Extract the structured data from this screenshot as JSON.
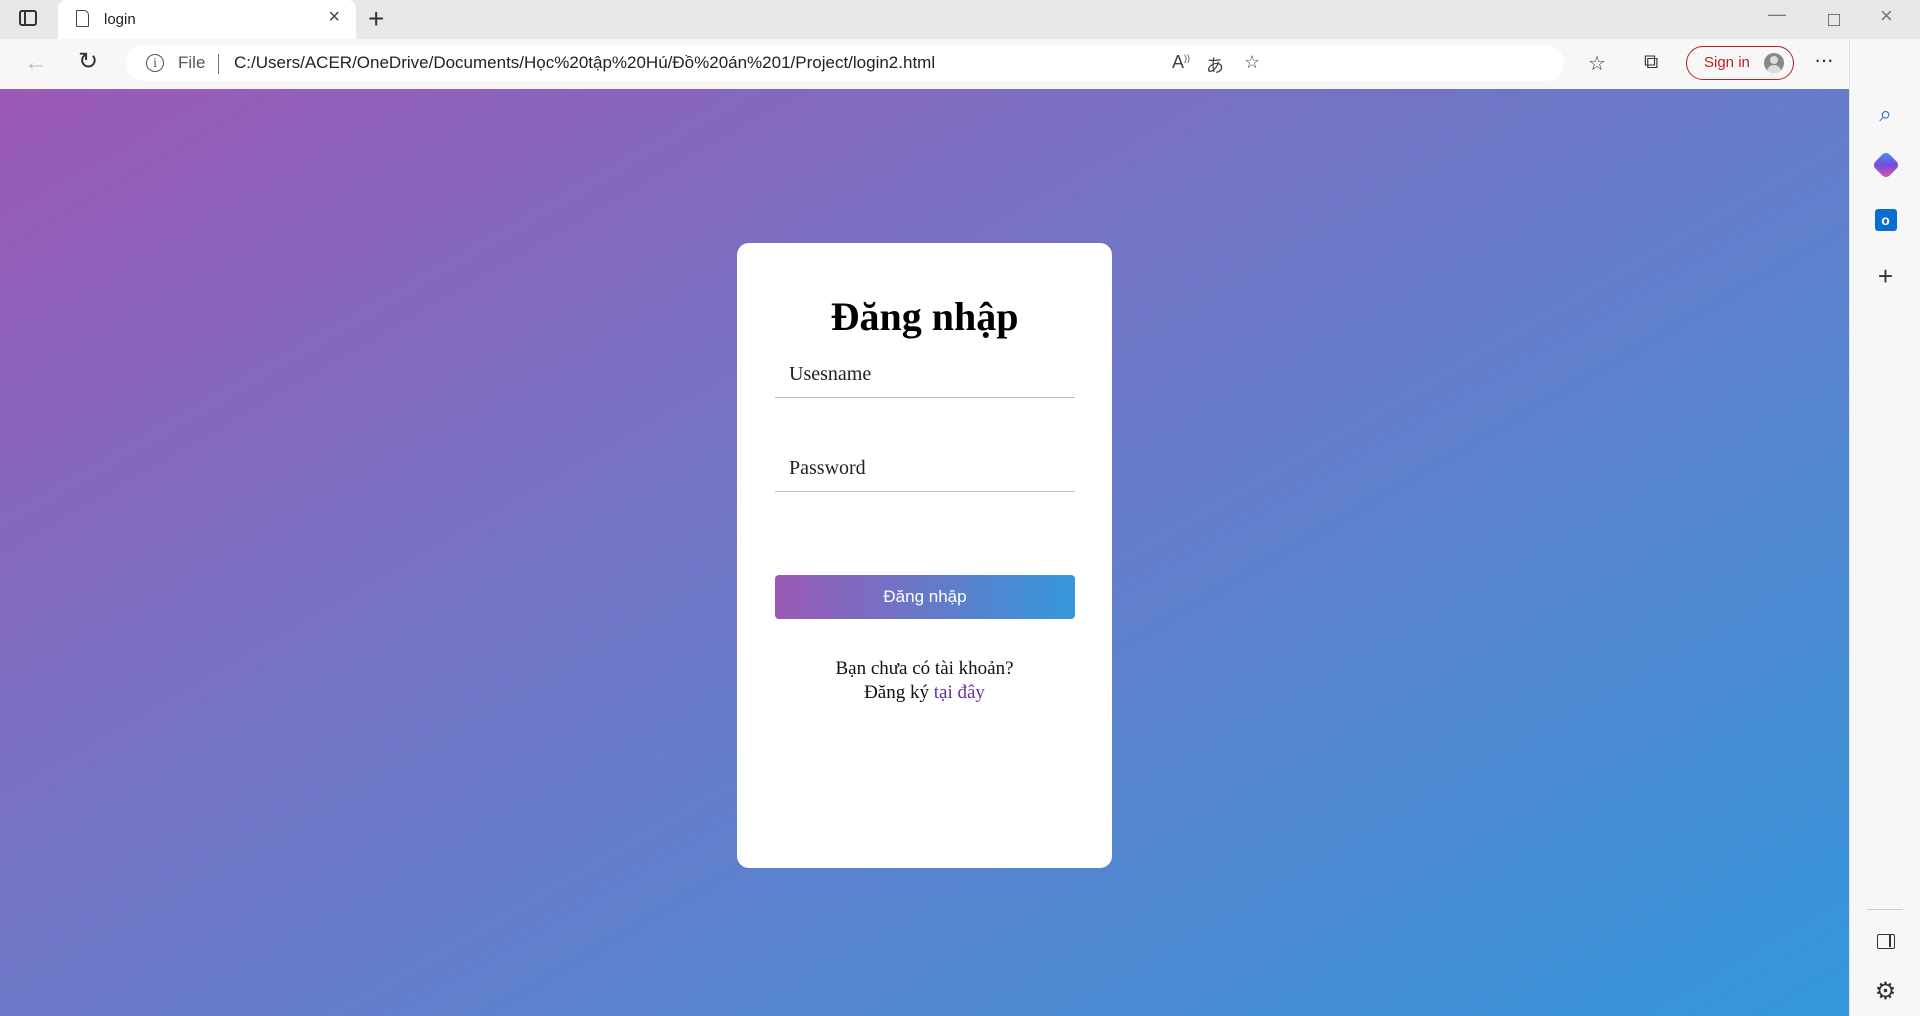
{
  "browser": {
    "tab": {
      "title": "login"
    },
    "address_bar": {
      "scheme_label": "File",
      "url": "C:/Users/ACER/OneDrive/Documents/Học%20tập%20Hú/Đồ%20án%201/Project/login2.html"
    },
    "sign_in_label": "Sign in",
    "toolbar_icons": [
      "read-aloud-icon",
      "translate-icon",
      "add-favorite-icon",
      "favorites-icon",
      "collections-icon",
      "more-icon",
      "bing-copilot-icon"
    ],
    "sidebar_icons": [
      "search-icon",
      "copilot-icon",
      "outlook-icon",
      "add-icon",
      "split-panel-icon",
      "settings-icon"
    ]
  },
  "login": {
    "title": "Đăng nhập",
    "username_placeholder": "Usesname",
    "password_placeholder": "Password",
    "submit_label": "Đăng nhập",
    "no_account_text": "Bạn chưa có tài khoản?",
    "register_prefix": "Đăng ký",
    "register_link": "tại đây"
  },
  "colors": {
    "gradient_start": "#9b59b6",
    "gradient_end": "#3498db",
    "link": "#6a2ea8",
    "sign_in_accent": "#b22222"
  }
}
